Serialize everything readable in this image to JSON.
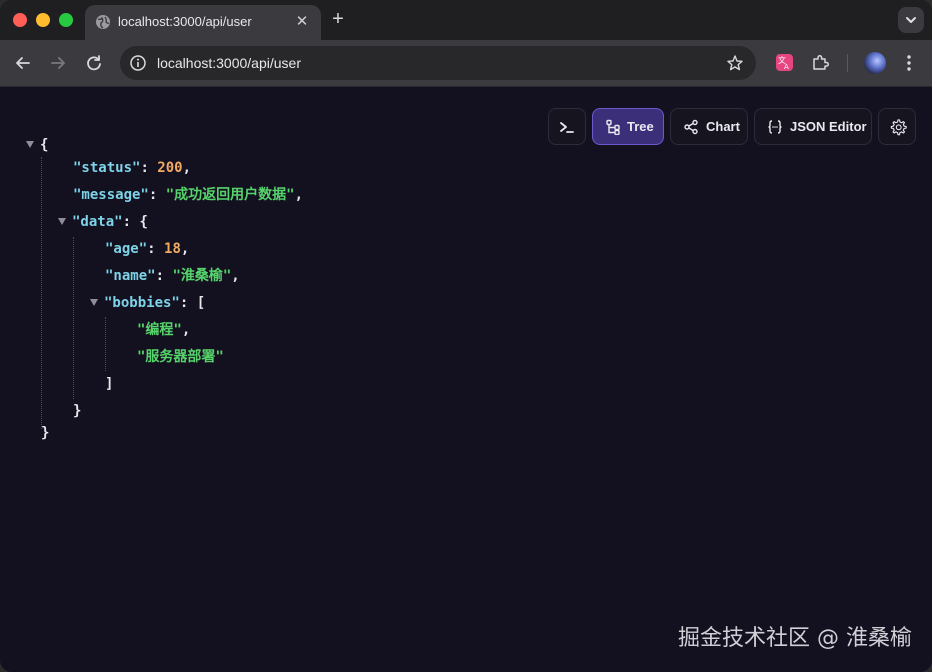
{
  "browser": {
    "tab": {
      "title": "localhost:3000/api/user",
      "favicon": "globe-icon"
    },
    "address_bar": {
      "url": "localhost:3000/api/user"
    },
    "icons": {
      "back": "arrow-left-icon",
      "forward": "arrow-right-icon",
      "reload": "reload-icon",
      "site_info": "info-icon",
      "bookmark": "star-icon",
      "translate_extension": "translate-icon",
      "extensions": "puzzle-icon",
      "menu": "kebab-menu-icon"
    }
  },
  "viewer_toolbar": {
    "terminal_icon": "terminal-icon",
    "tree_label": "Tree",
    "chart_label": "Chart",
    "json_editor_label": "JSON Editor",
    "settings_icon": "gear-icon",
    "active_view": "Tree"
  },
  "json": {
    "open_brace": "{",
    "close_brace": "}",
    "status_key": "\"status\"",
    "status_value": "200",
    "message_key": "\"message\"",
    "message_value": "\"成功返回用户数据\"",
    "data_key": "\"data\"",
    "data_open": "{",
    "data_close": "}",
    "age_key": "\"age\"",
    "age_value": "18",
    "name_key": "\"name\"",
    "name_value": "\"淮桑榆\"",
    "bobbies_key": "\"bobbies\"",
    "bobbies_open": "[",
    "bobbies_close": "]",
    "bobbies_items": [
      "\"编程\"",
      "\"服务器部署\""
    ]
  },
  "watermark": "掘金技术社区 @ 淮桑榆",
  "colors": {
    "background": "#13111f",
    "key": "#7dd3e8",
    "number": "#f2a964",
    "string": "#56d36b",
    "active_button": "#3b2f7a"
  }
}
